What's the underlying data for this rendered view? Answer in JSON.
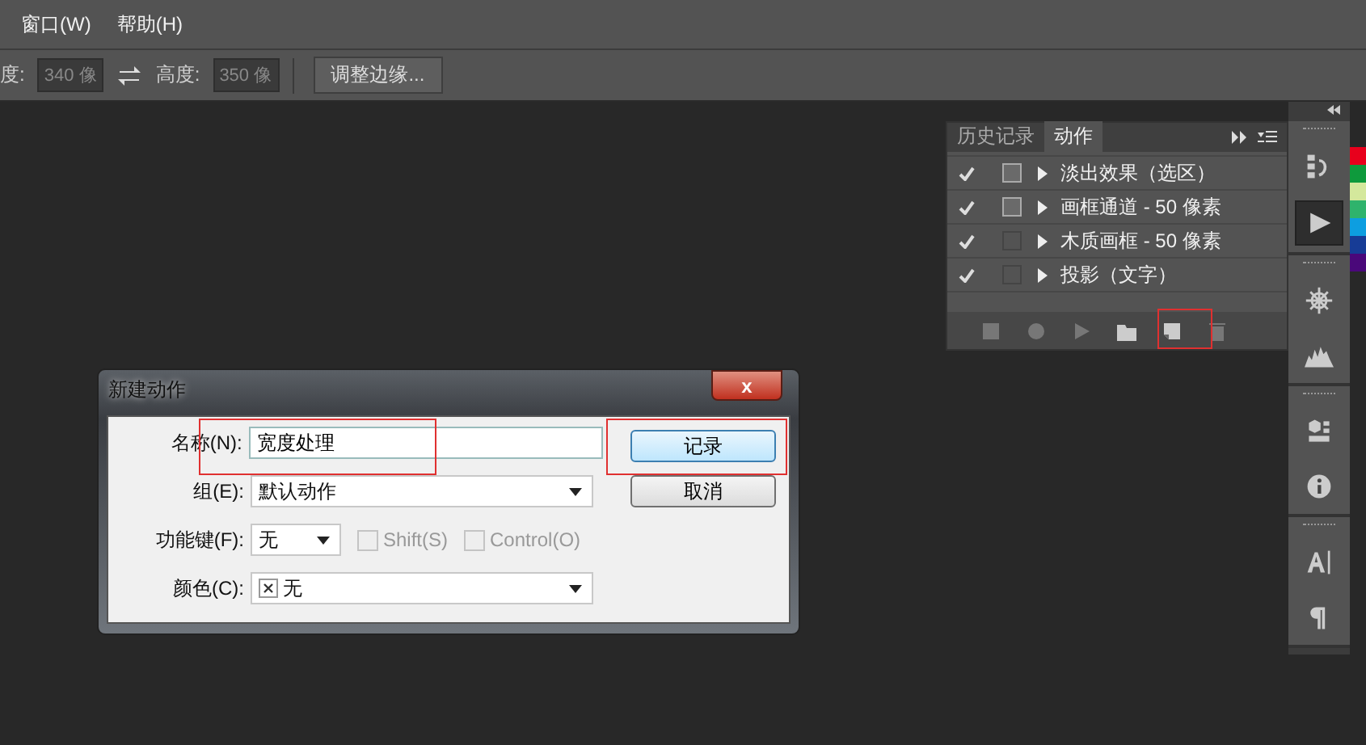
{
  "menu": [
    {
      "label": "窗口(W)"
    },
    {
      "label": "帮助(H)"
    }
  ],
  "options_bar": {
    "width_label": "度:",
    "width_value": "340 像",
    "height_label": "高度:",
    "height_value": "350 像",
    "refine_button": "调整边缘..."
  },
  "actions_panel": {
    "tabs": [
      {
        "label": "历史记录",
        "selected": false
      },
      {
        "label": "动作",
        "selected": true
      }
    ],
    "rows": [
      {
        "label": "淡出效果（选区）",
        "enabled": true,
        "dialog": true
      },
      {
        "label": "画框通道 - 50 像素",
        "enabled": true,
        "dialog": true
      },
      {
        "label": "木质画框 - 50 像素",
        "enabled": true,
        "dialog": false
      },
      {
        "label": "投影（文字）",
        "enabled": true,
        "dialog": false
      }
    ],
    "footer": [
      {
        "kind": "stop"
      },
      {
        "kind": "record"
      },
      {
        "kind": "play"
      },
      {
        "kind": "folder"
      },
      {
        "kind": "new"
      },
      {
        "kind": "trash"
      }
    ]
  },
  "dock": [
    {
      "kind": "history",
      "selected": false
    },
    {
      "kind": "play",
      "selected": true
    },
    {
      "kind": "wheel",
      "selected": false
    },
    {
      "kind": "histogram",
      "selected": false
    },
    {
      "kind": "properties",
      "selected": false
    },
    {
      "kind": "info",
      "selected": false
    },
    {
      "kind": "character",
      "selected": false
    },
    {
      "kind": "paragraph",
      "selected": false
    }
  ],
  "swatches": [
    {
      "color": "#e8001c"
    },
    {
      "color": "#0e9a3c"
    },
    {
      "color": "#d4e89c"
    },
    {
      "color": "#2fb36c"
    },
    {
      "color": "#0d9ee0"
    },
    {
      "color": "#173c96"
    },
    {
      "color": "#4a087a"
    }
  ],
  "dialog": {
    "title": "新建动作",
    "close": "x",
    "fields": [
      {
        "kind": "text",
        "label": "名称(N):",
        "value": "宽度处理"
      },
      {
        "kind": "select",
        "label": "组(E):",
        "value": "默认动作"
      },
      {
        "kind": "key",
        "label": "功能键(F):",
        "value": "无",
        "checkboxes": [
          {
            "label": "Shift(S)",
            "checked": false,
            "disabled": true
          },
          {
            "label": "Control(O)",
            "checked": false,
            "disabled": true
          }
        ]
      },
      {
        "kind": "color",
        "label": "颜色(C):",
        "value": "无"
      }
    ],
    "buttons": [
      {
        "label": "记录",
        "default": true
      },
      {
        "label": "取消",
        "default": false
      }
    ]
  },
  "highlight_frames": [
    {
      "kind": "name_field"
    },
    {
      "kind": "record_button"
    },
    {
      "kind": "new_action_button"
    }
  ]
}
